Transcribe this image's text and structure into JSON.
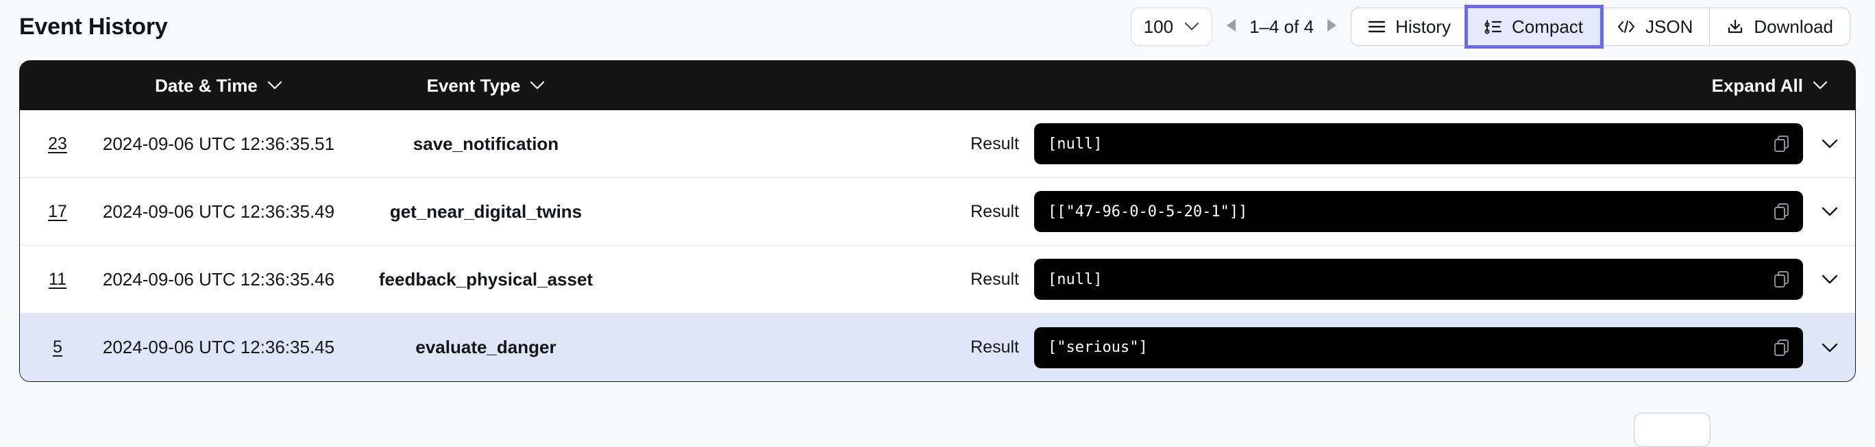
{
  "header": {
    "title": "Event History",
    "page_size": {
      "value": "100",
      "icon": "chevron-down-icon"
    },
    "pagination": {
      "prev_icon": "triangle-left-icon",
      "range_label": "1–4 of 4",
      "next_icon": "triangle-right-icon"
    },
    "view_buttons": [
      {
        "label": "History",
        "icon": "list-lines-icon",
        "active": false
      },
      {
        "label": "Compact",
        "icon": "compact-tree-icon",
        "active": true
      },
      {
        "label": "JSON",
        "icon": "code-brackets-icon",
        "active": false
      },
      {
        "label": "Download",
        "icon": "download-icon",
        "active": false
      }
    ]
  },
  "table": {
    "columns": {
      "id": "",
      "date": "Date & Time",
      "type": "Event Type",
      "expand_all": "Expand All"
    },
    "sort_icon": "chevron-down-icon",
    "expand_icon": "chevron-down-icon",
    "result_label": "Result",
    "copy_icon": "copy-icon",
    "row_toggle_icon": "chevron-down-icon",
    "rows": [
      {
        "id": "23",
        "datetime": "2024-09-06 UTC 12:36:35.51",
        "event_type": "save_notification",
        "result_label": "Result",
        "result": "[null]",
        "selected": false
      },
      {
        "id": "17",
        "datetime": "2024-09-06 UTC 12:36:35.49",
        "event_type": "get_near_digital_twins",
        "result_label": "Result",
        "result": "[[\"47-96-0-0-5-20-1\"]]",
        "selected": false
      },
      {
        "id": "11",
        "datetime": "2024-09-06 UTC 12:36:35.46",
        "event_type": "feedback_physical_asset",
        "result_label": "Result",
        "result": "[null]",
        "selected": false
      },
      {
        "id": "5",
        "datetime": "2024-09-06 UTC 12:36:35.45",
        "event_type": "evaluate_danger",
        "result_label": "Result",
        "result": "[\"serious\"]",
        "selected": true
      }
    ]
  },
  "colors": {
    "page_bg": "#f8f9fb",
    "header_bg": "#141414",
    "selected_row": "#dfe6f8",
    "active_button_bg": "#e4eafb",
    "focus_ring": "#6c6ce0",
    "code_bg": "#000000"
  }
}
